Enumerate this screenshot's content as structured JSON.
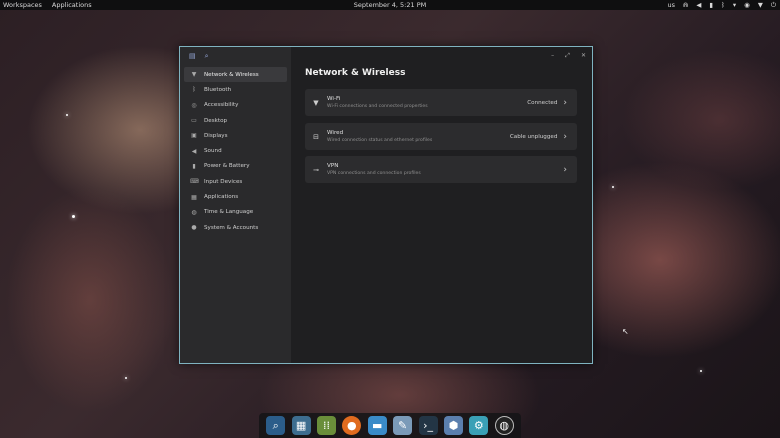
{
  "topbar": {
    "workspaces": "Workspaces",
    "applications": "Applications",
    "clock": "September 4, 5:21 PM",
    "keyboard_layout": "us"
  },
  "window": {
    "title": "Network & Wireless",
    "sidebar": {
      "items": [
        {
          "label": "Network & Wireless",
          "icon": "wifi-icon",
          "active": true
        },
        {
          "label": "Bluetooth",
          "icon": "bluetooth-icon",
          "active": false
        },
        {
          "label": "Accessibility",
          "icon": "accessibility-icon",
          "active": false
        },
        {
          "label": "Desktop",
          "icon": "desktop-icon",
          "active": false
        },
        {
          "label": "Displays",
          "icon": "display-icon",
          "active": false
        },
        {
          "label": "Sound",
          "icon": "sound-icon",
          "active": false
        },
        {
          "label": "Power & Battery",
          "icon": "battery-icon",
          "active": false
        },
        {
          "label": "Input Devices",
          "icon": "keyboard-icon",
          "active": false
        },
        {
          "label": "Applications",
          "icon": "apps-icon",
          "active": false
        },
        {
          "label": "Time & Language",
          "icon": "globe-icon",
          "active": false
        },
        {
          "label": "System & Accounts",
          "icon": "user-icon",
          "active": false
        }
      ]
    },
    "rows": [
      {
        "title": "Wi-Fi",
        "desc": "Wi-Fi connections and connected properties",
        "status": "Connected",
        "icon": "wifi-icon"
      },
      {
        "title": "Wired",
        "desc": "Wired connection status and ethernet profiles",
        "status": "Cable unplugged",
        "icon": "ethernet-icon"
      },
      {
        "title": "VPN",
        "desc": "VPN connections and connection profiles",
        "status": "",
        "icon": "key-icon"
      }
    ]
  },
  "dock": {
    "items": [
      "search-app-icon",
      "files-manager-icon",
      "app-grid-icon",
      "firefox-icon",
      "folder-icon",
      "text-editor-icon",
      "terminal-icon",
      "store-icon",
      "settings-icon",
      "obs-icon"
    ]
  },
  "colors": {
    "window_border": "#7fb3c0",
    "sidebar_bg": "#2a2a2c",
    "main_bg": "#1f1f21",
    "row_bg": "#2c2c2e"
  }
}
